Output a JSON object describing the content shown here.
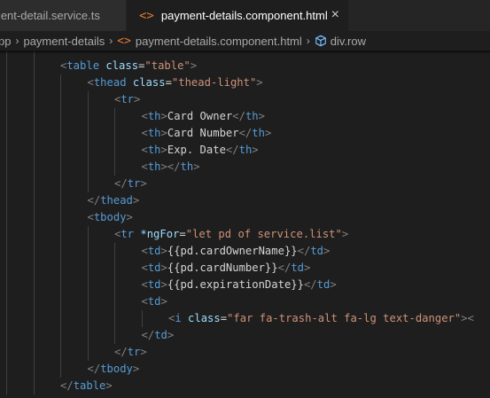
{
  "tabs": [
    {
      "label": "ment-detail.service.ts",
      "active": false
    },
    {
      "label": "payment-details.component.html",
      "active": true,
      "icon": "code-brackets-icon",
      "close": "×"
    }
  ],
  "breadcrumb": {
    "items": [
      "pp",
      "payment-details",
      "payment-details.component.html",
      "div.row"
    ],
    "separator": "›",
    "file_icon": "code-brackets-icon",
    "symbol_icon": "cube-icon"
  },
  "colors": {
    "tag": "#569cd6",
    "attribute": "#9cdcfe",
    "string": "#ce9178",
    "text": "#d4d4d4",
    "punctuation": "#808080",
    "file_icon": "#e37933"
  },
  "code_lines": [
    {
      "indent": 2,
      "tokens": [
        [
          "pn",
          "<"
        ],
        [
          "tg",
          "table"
        ],
        [
          "tx",
          " "
        ],
        [
          "at",
          "class"
        ],
        [
          "tx",
          "="
        ],
        [
          "st",
          "\"table\""
        ],
        [
          "pn",
          ">"
        ]
      ]
    },
    {
      "indent": 3,
      "tokens": [
        [
          "pn",
          "<"
        ],
        [
          "tg",
          "thead"
        ],
        [
          "tx",
          " "
        ],
        [
          "at",
          "class"
        ],
        [
          "tx",
          "="
        ],
        [
          "st",
          "\"thead-light\""
        ],
        [
          "pn",
          ">"
        ]
      ]
    },
    {
      "indent": 4,
      "tokens": [
        [
          "pn",
          "<"
        ],
        [
          "tg",
          "tr"
        ],
        [
          "pn",
          ">"
        ]
      ]
    },
    {
      "indent": 5,
      "tokens": [
        [
          "pn",
          "<"
        ],
        [
          "tg",
          "th"
        ],
        [
          "pn",
          ">"
        ],
        [
          "tx",
          "Card Owner"
        ],
        [
          "pn",
          "</"
        ],
        [
          "tg",
          "th"
        ],
        [
          "pn",
          ">"
        ]
      ]
    },
    {
      "indent": 5,
      "tokens": [
        [
          "pn",
          "<"
        ],
        [
          "tg",
          "th"
        ],
        [
          "pn",
          ">"
        ],
        [
          "tx",
          "Card Number"
        ],
        [
          "pn",
          "</"
        ],
        [
          "tg",
          "th"
        ],
        [
          "pn",
          ">"
        ]
      ]
    },
    {
      "indent": 5,
      "tokens": [
        [
          "pn",
          "<"
        ],
        [
          "tg",
          "th"
        ],
        [
          "pn",
          ">"
        ],
        [
          "tx",
          "Exp. Date"
        ],
        [
          "pn",
          "</"
        ],
        [
          "tg",
          "th"
        ],
        [
          "pn",
          ">"
        ]
      ]
    },
    {
      "indent": 5,
      "tokens": [
        [
          "pn",
          "<"
        ],
        [
          "tg",
          "th"
        ],
        [
          "pn",
          "></"
        ],
        [
          "tg",
          "th"
        ],
        [
          "pn",
          ">"
        ]
      ]
    },
    {
      "indent": 4,
      "tokens": [
        [
          "pn",
          "</"
        ],
        [
          "tg",
          "tr"
        ],
        [
          "pn",
          ">"
        ]
      ]
    },
    {
      "indent": 3,
      "tokens": [
        [
          "pn",
          "</"
        ],
        [
          "tg",
          "thead"
        ],
        [
          "pn",
          ">"
        ]
      ]
    },
    {
      "indent": 3,
      "tokens": [
        [
          "pn",
          "<"
        ],
        [
          "tg",
          "tbody"
        ],
        [
          "pn",
          ">"
        ]
      ]
    },
    {
      "indent": 4,
      "tokens": [
        [
          "pn",
          "<"
        ],
        [
          "tg",
          "tr"
        ],
        [
          "tx",
          " "
        ],
        [
          "at",
          "*ngFor"
        ],
        [
          "tx",
          "="
        ],
        [
          "st",
          "\"let pd of service.list\""
        ],
        [
          "pn",
          ">"
        ]
      ]
    },
    {
      "indent": 5,
      "tokens": [
        [
          "pn",
          "<"
        ],
        [
          "tg",
          "td"
        ],
        [
          "pn",
          ">"
        ],
        [
          "tx",
          "{{pd.cardOwnerName}}"
        ],
        [
          "pn",
          "</"
        ],
        [
          "tg",
          "td"
        ],
        [
          "pn",
          ">"
        ]
      ]
    },
    {
      "indent": 5,
      "tokens": [
        [
          "pn",
          "<"
        ],
        [
          "tg",
          "td"
        ],
        [
          "pn",
          ">"
        ],
        [
          "tx",
          "{{pd.cardNumber}}"
        ],
        [
          "pn",
          "</"
        ],
        [
          "tg",
          "td"
        ],
        [
          "pn",
          ">"
        ]
      ]
    },
    {
      "indent": 5,
      "tokens": [
        [
          "pn",
          "<"
        ],
        [
          "tg",
          "td"
        ],
        [
          "pn",
          ">"
        ],
        [
          "tx",
          "{{pd.expirationDate}}"
        ],
        [
          "pn",
          "</"
        ],
        [
          "tg",
          "td"
        ],
        [
          "pn",
          ">"
        ]
      ]
    },
    {
      "indent": 5,
      "tokens": [
        [
          "pn",
          "<"
        ],
        [
          "tg",
          "td"
        ],
        [
          "pn",
          ">"
        ]
      ]
    },
    {
      "indent": 6,
      "tokens": [
        [
          "pn",
          "<"
        ],
        [
          "tg",
          "i"
        ],
        [
          "tx",
          " "
        ],
        [
          "at",
          "class"
        ],
        [
          "tx",
          "="
        ],
        [
          "st",
          "\"far fa-trash-alt fa-lg text-danger\""
        ],
        [
          "pn",
          "><"
        ]
      ]
    },
    {
      "indent": 5,
      "tokens": [
        [
          "pn",
          "</"
        ],
        [
          "tg",
          "td"
        ],
        [
          "pn",
          ">"
        ]
      ]
    },
    {
      "indent": 4,
      "tokens": [
        [
          "pn",
          "</"
        ],
        [
          "tg",
          "tr"
        ],
        [
          "pn",
          ">"
        ]
      ]
    },
    {
      "indent": 3,
      "tokens": [
        [
          "pn",
          "</"
        ],
        [
          "tg",
          "tbody"
        ],
        [
          "pn",
          ">"
        ]
      ]
    },
    {
      "indent": 2,
      "tokens": [
        [
          "pn",
          "</"
        ],
        [
          "tg",
          "table"
        ],
        [
          "pn",
          ">"
        ]
      ]
    }
  ]
}
